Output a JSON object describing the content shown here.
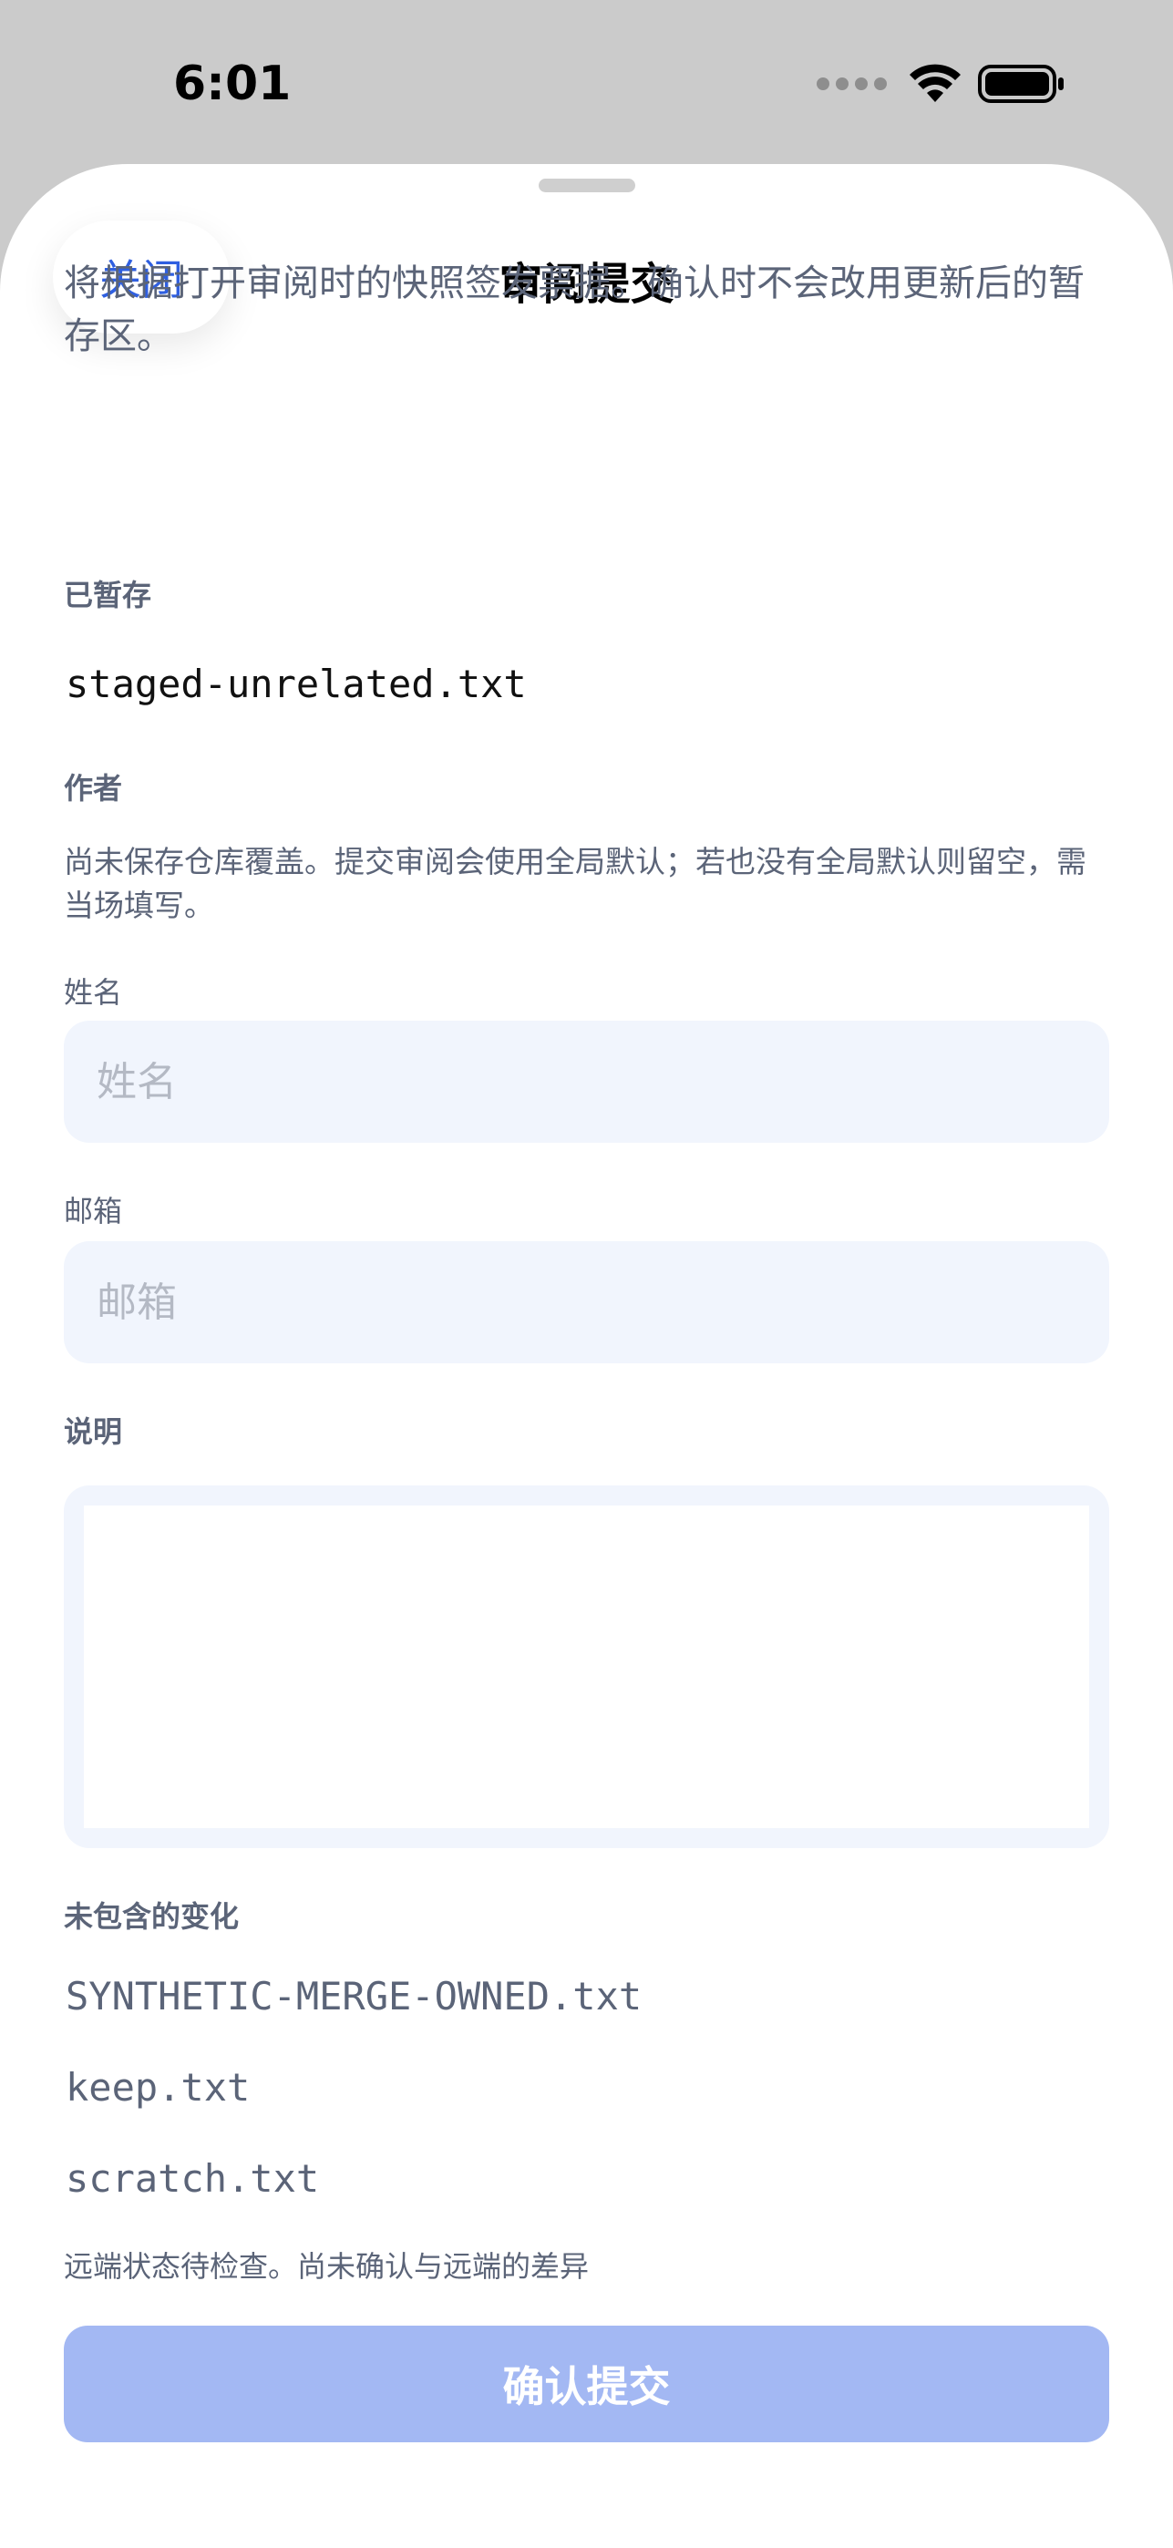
{
  "status_bar": {
    "time": "6:01"
  },
  "header": {
    "close_label": "关闭",
    "title": "审阅提交"
  },
  "intro_text": "将根据打开审阅时的快照签发票据。确认时不会改用更新后的暂存区。",
  "staged": {
    "label": "已暂存",
    "files": [
      "staged-unrelated.txt"
    ]
  },
  "author": {
    "label": "作者",
    "hint": "尚未保存仓库覆盖。提交审阅会使用全局默认；若也没有全局默认则留空，需当场填写。",
    "name_label": "姓名",
    "name_placeholder": "姓名",
    "name_value": "",
    "email_label": "邮箱",
    "email_placeholder": "邮箱",
    "email_value": ""
  },
  "description": {
    "label": "说明",
    "value": ""
  },
  "excluded": {
    "label": "未包含的变化",
    "files": [
      "SYNTHETIC-MERGE-OWNED.txt",
      "keep.txt",
      "scratch.txt"
    ]
  },
  "remote_status": "远端状态待检查。尚未确认与远端的差异",
  "confirm_label": "确认提交",
  "colors": {
    "accent": "#2f5fe0",
    "button_disabled": "#a3b8f3",
    "field_bg": "#f1f5fd"
  }
}
